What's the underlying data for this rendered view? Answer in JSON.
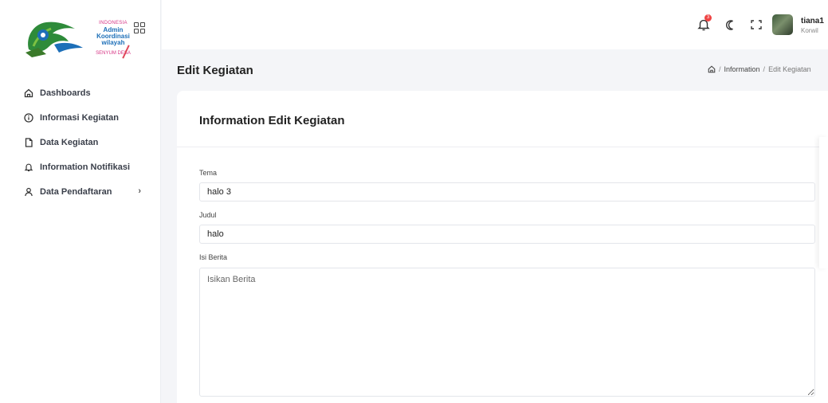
{
  "logo": {
    "line1": "INDONESIA",
    "line2": "Admin Koordinasi wilayah",
    "line3": "SENYUM DESA"
  },
  "sidebar": {
    "items": [
      {
        "label": "Dashboards",
        "icon": "home-icon"
      },
      {
        "label": "Informasi Kegiatan",
        "icon": "info-icon"
      },
      {
        "label": "Data Kegiatan",
        "icon": "file-icon"
      },
      {
        "label": "Information Notifikasi",
        "icon": "bell-icon"
      },
      {
        "label": "Data Pendaftaran",
        "icon": "user-icon",
        "has_submenu": true
      }
    ]
  },
  "topbar": {
    "notification_count": "3",
    "user_name": "tiana1",
    "user_role": "Korwil"
  },
  "page": {
    "title": "Edit Kegiatan",
    "breadcrumb": [
      "Information",
      "Edit Kegiatan"
    ]
  },
  "form": {
    "title": "Information Edit Kegiatan",
    "tema_label": "Tema",
    "tema_value": "halo 3",
    "judul_label": "Judul",
    "judul_value": "halo",
    "isi_label": "Isi Berita",
    "isi_placeholder": "Isikan Berita",
    "isi_value": ""
  },
  "colors": {
    "accent_pink": "#d63384",
    "accent_blue": "#1d6fb8",
    "badge_red": "#ef4444",
    "page_bg": "#f4f5f8"
  }
}
